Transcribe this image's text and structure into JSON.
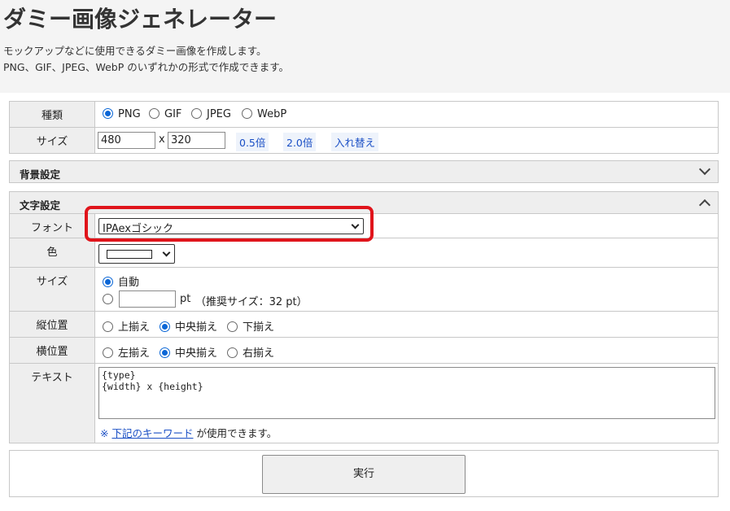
{
  "title": "ダミー画像ジェネレーター",
  "description": [
    "モックアップなどに使用できるダミー画像を作成します。",
    "PNG、GIF、JPEG、WebP のいずれかの形式で作成できます。"
  ],
  "type_row": {
    "label": "種類",
    "options": [
      "PNG",
      "GIF",
      "JPEG",
      "WebP"
    ],
    "selected": "PNG"
  },
  "size_row": {
    "label": "サイズ",
    "width": "480",
    "separator": "x",
    "height": "320",
    "half_button": "0.5倍",
    "double_button": "2.0倍",
    "swap_button": "入れ替え"
  },
  "background_section": {
    "title": "背景設定"
  },
  "text_section": {
    "title": "文字設定",
    "font": {
      "label": "フォント",
      "selected": "IPAexゴシック"
    },
    "color": {
      "label": "色",
      "swatch": "#ffffff"
    },
    "text_size": {
      "label": "サイズ",
      "auto_label": "自動",
      "unit": "pt",
      "recommended": "（推奨サイズ：32 pt）"
    },
    "vertical": {
      "label": "縦位置",
      "options": [
        "上揃え",
        "中央揃え",
        "下揃え"
      ],
      "selected": "中央揃え"
    },
    "horizontal": {
      "label": "横位置",
      "options": [
        "左揃え",
        "中央揃え",
        "右揃え"
      ],
      "selected": "中央揃え"
    },
    "text": {
      "label": "テキスト",
      "value": "{type}\n{width} x {height}",
      "note_prefix": "※",
      "note_link": "下記のキーワード",
      "note_suffix": "が使用できます。"
    }
  },
  "run_button": "実行",
  "colors": {
    "accent": "#0a66d6",
    "highlight": "#e0141b",
    "link": "#1a4fc5"
  }
}
